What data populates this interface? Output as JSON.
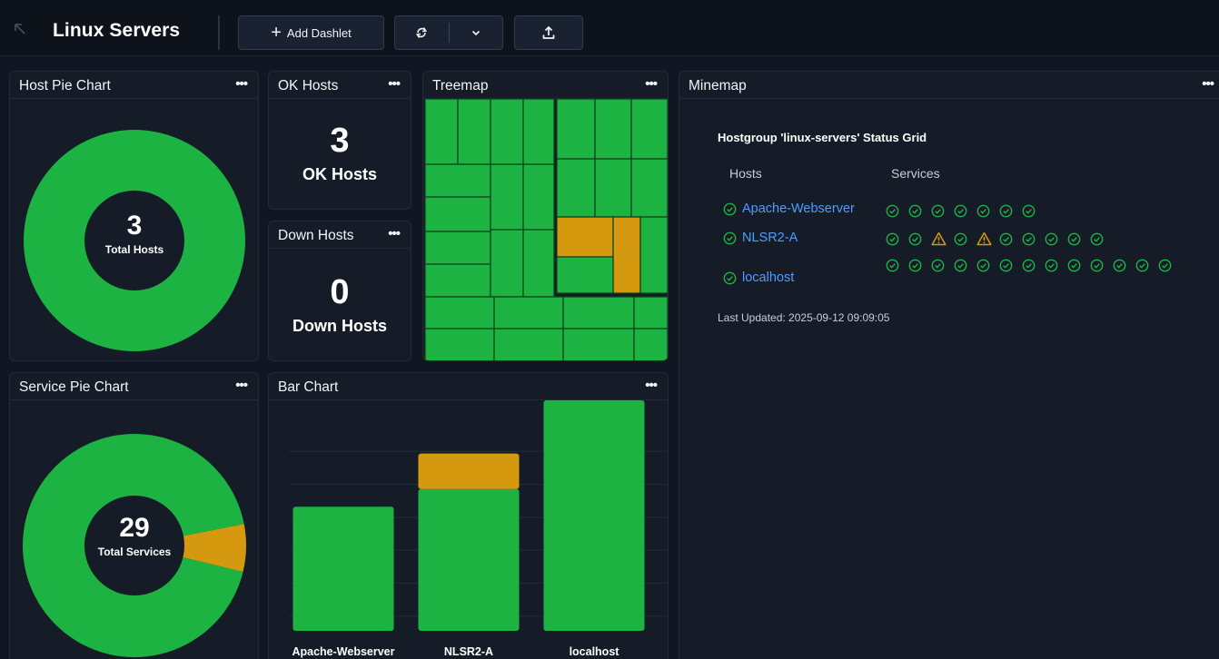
{
  "toolbar": {
    "title": "Linux Servers",
    "add_dashlet_label": "Add Dashlet",
    "icons": [
      "arrow-up-left-icon",
      "plus-icon",
      "refresh-icon",
      "chevron-down-icon",
      "upload-icon"
    ]
  },
  "dashlets": {
    "host_pie": {
      "title": "Host Pie Chart",
      "menu": "•••",
      "total": "3",
      "total_label": "Total Hosts"
    },
    "ok_hosts": {
      "title": "OK Hosts",
      "menu": "•••",
      "value": "3",
      "label": "OK Hosts"
    },
    "down_hosts": {
      "title": "Down Hosts",
      "menu": "•••",
      "value": "0",
      "label": "Down Hosts"
    },
    "treemap": {
      "title": "Treemap",
      "menu": "•••"
    },
    "minemap": {
      "title": "Minemap",
      "menu": "•••",
      "grid_title": "Hostgroup 'linux-servers' Status Grid",
      "hosts_header": "Hosts",
      "services_header": "Services",
      "hosts": [
        {
          "name": "Apache-Webserver",
          "status": "ok",
          "services": [
            "ok",
            "ok",
            "ok",
            "ok",
            "ok",
            "ok",
            "ok"
          ]
        },
        {
          "name": "NLSR2-A",
          "status": "ok",
          "services": [
            "ok",
            "ok",
            "warning",
            "ok",
            "warning",
            "ok",
            "ok",
            "ok",
            "ok",
            "ok"
          ]
        },
        {
          "name": "localhost",
          "status": "ok",
          "services": [
            "ok",
            "ok",
            "ok",
            "ok",
            "ok",
            "ok",
            "ok",
            "ok",
            "ok",
            "ok",
            "ok",
            "ok",
            "ok"
          ]
        }
      ],
      "last_updated": "Last Updated: 2025-09-12 09:09:05"
    },
    "service_pie": {
      "title": "Service Pie Chart",
      "menu": "•••",
      "total": "29",
      "total_label": "Total Services"
    },
    "bar_chart": {
      "title": "Bar Chart",
      "menu": "•••"
    }
  },
  "colors": {
    "ok": "#1db343",
    "warning": "#d4990f",
    "link": "#4f9dff",
    "background": "#111722",
    "panel": "#151c28"
  },
  "chart_data": [
    {
      "type": "pie",
      "name": "host-pie",
      "slices": [
        {
          "label": "OK",
          "value": 3,
          "color": "#1db343"
        }
      ],
      "center_value": "3",
      "center_label": "Total Hosts"
    },
    {
      "type": "pie",
      "name": "service-pie",
      "slices": [
        {
          "label": "OK",
          "value": 27,
          "color": "#1db343"
        },
        {
          "label": "Warning",
          "value": 2,
          "color": "#d4990f"
        }
      ],
      "center_value": "29",
      "center_label": "Total Services"
    },
    {
      "type": "bar",
      "name": "bar-chart",
      "stacked": true,
      "categories": [
        "Apache-Webserver",
        "NLSR2-A",
        "localhost"
      ],
      "series": [
        {
          "values": [
            7,
            8,
            13
          ],
          "color": "#1db343"
        },
        {
          "values": [
            0,
            2,
            0
          ],
          "color": "#d4990f"
        }
      ],
      "ylim": [
        0,
        13
      ],
      "grid": true
    }
  ]
}
